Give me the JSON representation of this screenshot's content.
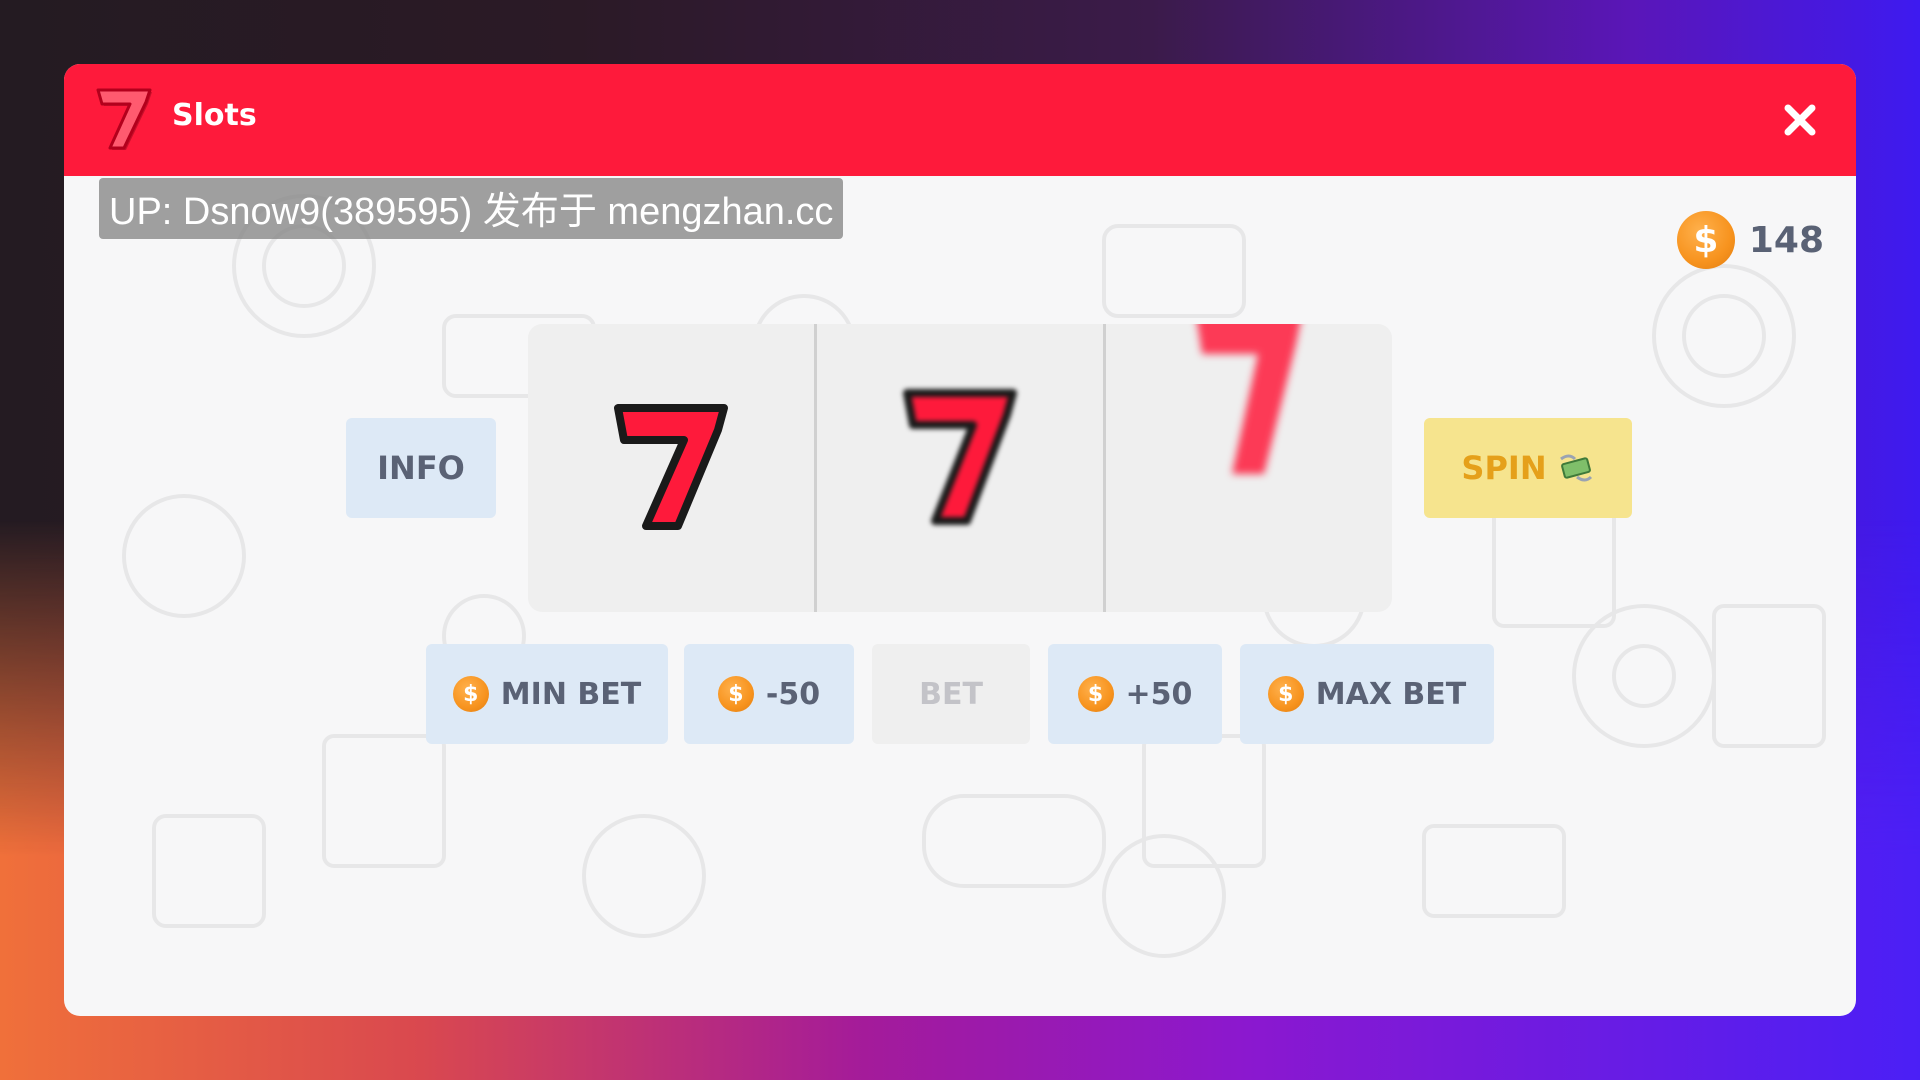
{
  "header": {
    "title": "Slots",
    "logo_icon": "lucky-seven-icon",
    "close_icon": "close-icon",
    "color": "#fe1a3b"
  },
  "watermark": {
    "text": "UP: Dsnow9(389595) 发布于 mengzhan.cc"
  },
  "balance": {
    "coin_symbol": "$",
    "value": "148"
  },
  "reels": [
    {
      "symbol": "seven",
      "state": "stopped"
    },
    {
      "symbol": "seven",
      "state": "spinning"
    },
    {
      "symbol": "seven",
      "state": "spinning"
    }
  ],
  "controls": {
    "info_label": "INFO",
    "spin_label": "SPIN",
    "spin_icon": "money-wings-icon"
  },
  "bet_row": {
    "coin_symbol": "$",
    "min_bet_label": "MIN BET",
    "minus_label": "-50",
    "bet_label": "BET",
    "plus_label": "+50",
    "max_bet_label": "MAX BET"
  },
  "colors": {
    "accent_red": "#fe1a3b",
    "spin_yellow": "#f6e48e",
    "button_blue": "#dde9f6",
    "coin_orange": "#f7931e"
  }
}
